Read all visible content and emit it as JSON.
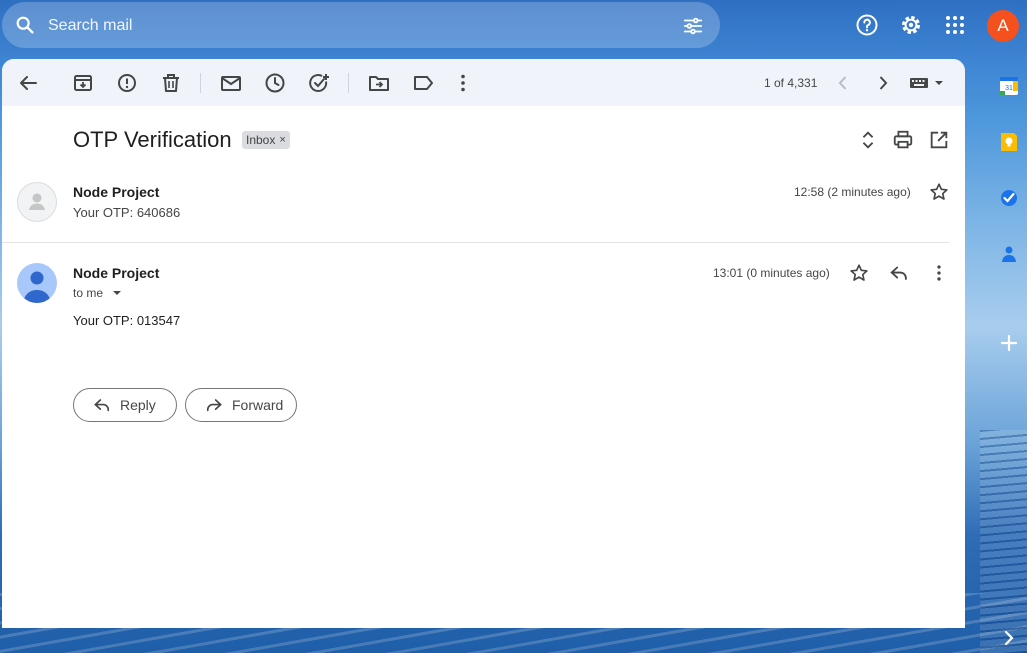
{
  "search": {
    "placeholder": "Search mail"
  },
  "account": {
    "initial": "A"
  },
  "toolbar": {
    "pager": "1 of 4,331"
  },
  "email": {
    "subject": "OTP Verification",
    "label": "Inbox",
    "label_remove": "×",
    "messages": [
      {
        "sender": "Node Project",
        "snippet": "Your OTP: 640686",
        "time": "12:58 (2 minutes ago)"
      },
      {
        "sender": "Node Project",
        "recipient": "to me",
        "body": "Your OTP: 013547",
        "time": "13:01 (0 minutes ago)"
      }
    ]
  },
  "actions": {
    "reply": "Reply",
    "forward": "Forward"
  },
  "colors": {
    "accent": "#0b57d0",
    "avatar_bg": "#f4511e",
    "panel_bg": "#ffffff",
    "toolbar_bg": "#f0f4fa"
  }
}
